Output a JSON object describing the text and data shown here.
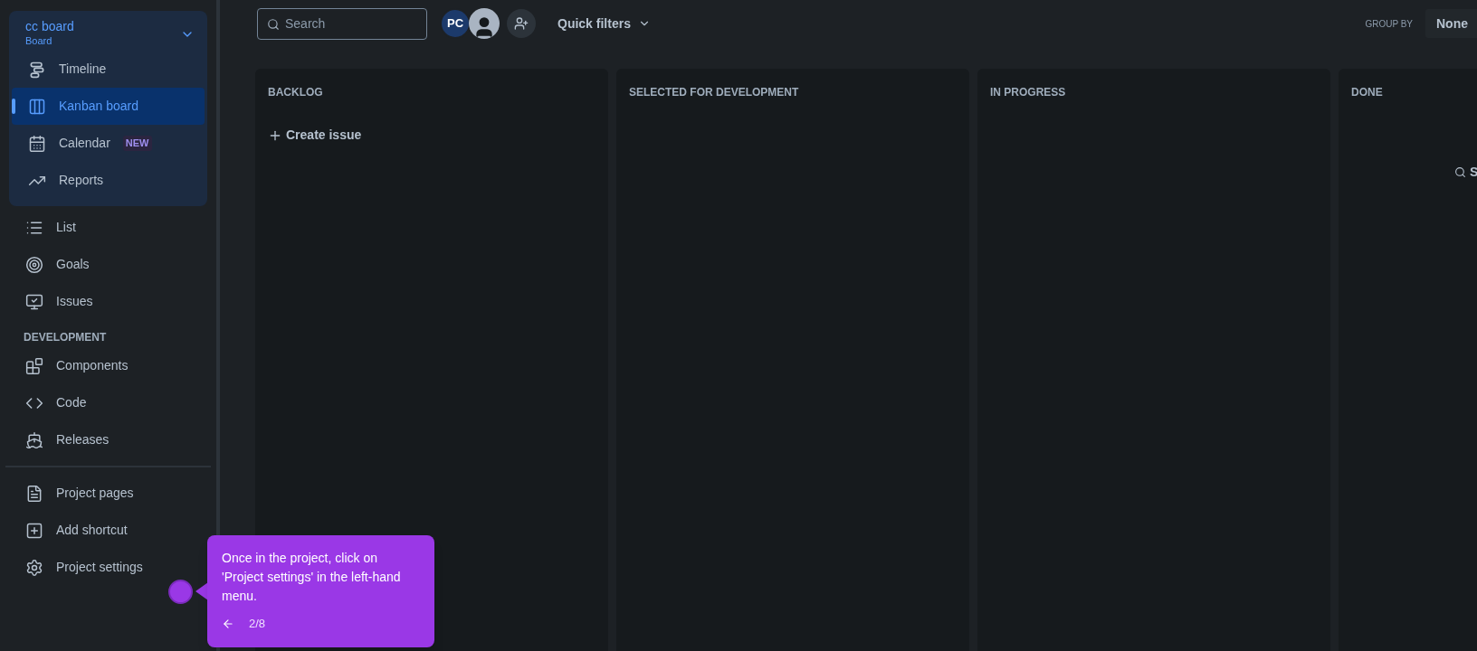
{
  "project": {
    "name": "cc board",
    "subtitle": "Board",
    "expanded": true
  },
  "planning_items": [
    {
      "label": "Timeline",
      "selected": false
    },
    {
      "label": "Kanban board",
      "selected": true
    },
    {
      "label": "Calendar",
      "selected": false,
      "badge": "NEW"
    },
    {
      "label": "Reports",
      "selected": false
    }
  ],
  "nav_items": [
    {
      "label": "List"
    },
    {
      "label": "Goals"
    },
    {
      "label": "Issues"
    }
  ],
  "development": {
    "heading": "DEVELOPMENT",
    "items": [
      {
        "label": "Components"
      },
      {
        "label": "Code"
      },
      {
        "label": "Releases"
      }
    ]
  },
  "footer_items": [
    {
      "label": "Project pages"
    },
    {
      "label": "Add shortcut"
    },
    {
      "label": "Project settings"
    }
  ],
  "toolbar": {
    "search_placeholder": "Search",
    "avatar_initials": "PC",
    "quick_filters": "Quick filters",
    "group_by_label": "GROUP BY",
    "group_by_value": "None"
  },
  "columns": [
    {
      "title": "BACKLOG",
      "action": "Create issue"
    },
    {
      "title": "SELECTED FOR DEVELOPMENT"
    },
    {
      "title": "IN PROGRESS"
    },
    {
      "title": "DONE",
      "search_text": "S"
    }
  ],
  "tooltip": {
    "text": "Once in the project, click on 'Project settings' in the left-hand menu.",
    "step": "2/8"
  }
}
